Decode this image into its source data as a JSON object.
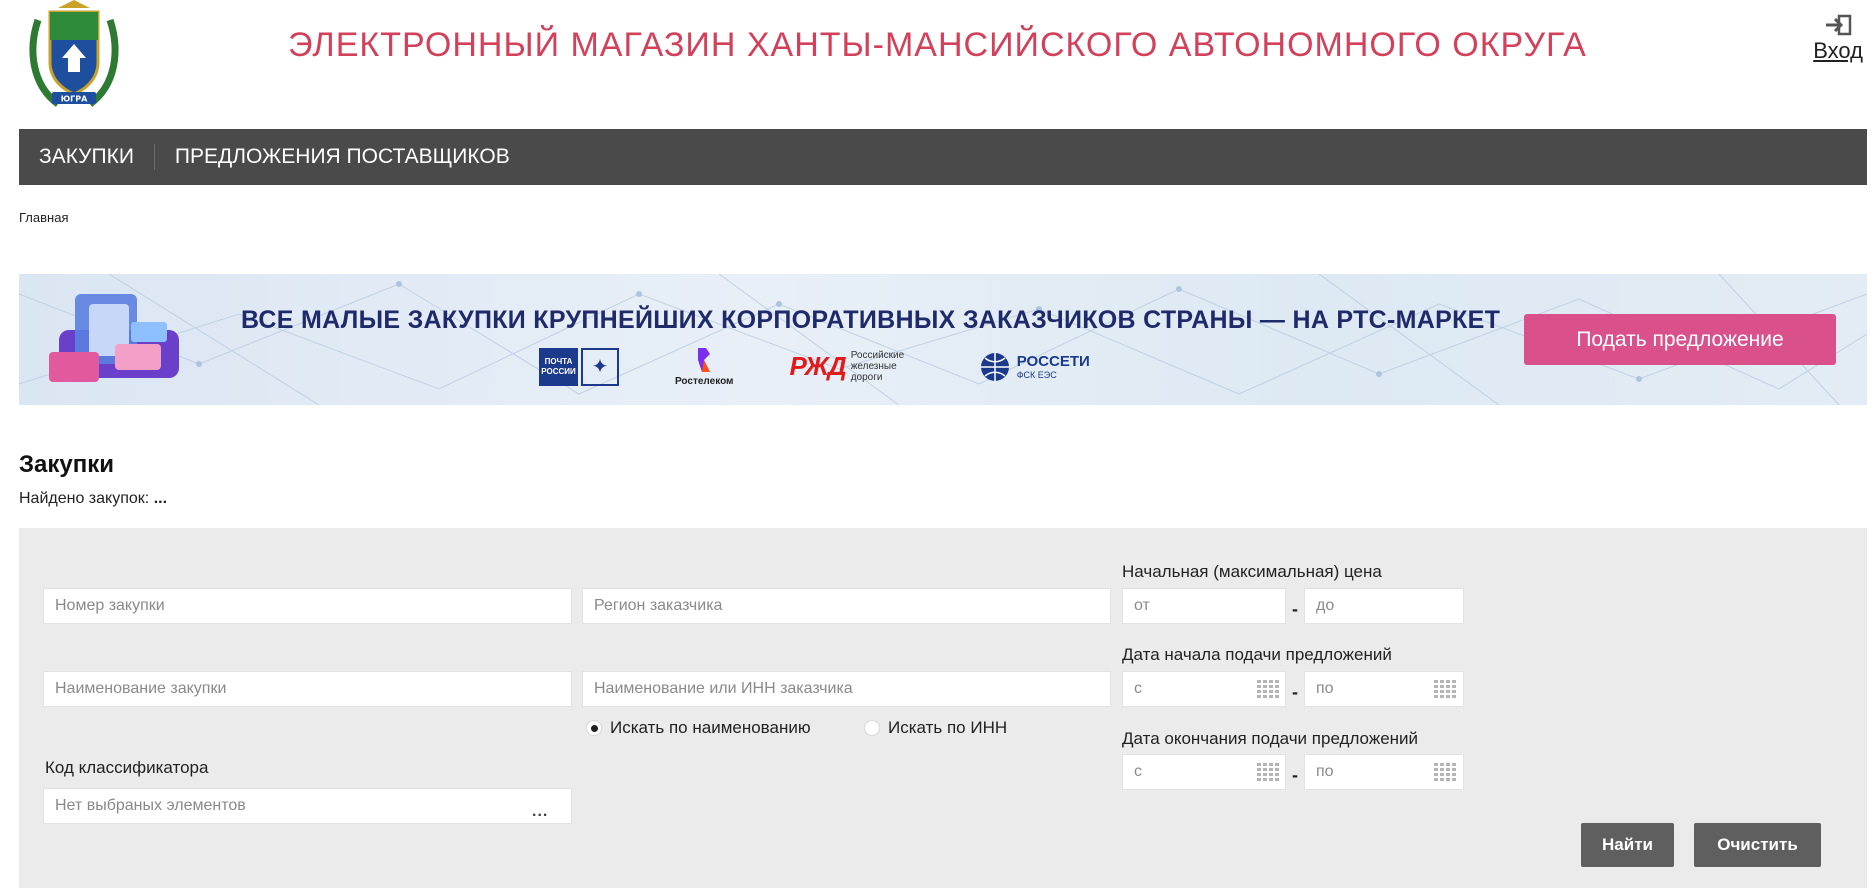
{
  "header": {
    "title": "ЭЛЕКТРОННЫЙ МАГАЗИН ХАНТЫ-МАНСИЙСКОГО АВТОНОМНОГО ОКРУГА",
    "logo_text": "ЮГРА",
    "login_label": "Вход"
  },
  "nav": {
    "items": [
      {
        "label": "ЗАКУПКИ"
      },
      {
        "label": "ПРЕДЛОЖЕНИЯ ПОСТАВЩИКОВ"
      }
    ]
  },
  "breadcrumb": "Главная",
  "banner": {
    "headline": "ВСЕ МАЛЫЕ ЗАКУПКИ КРУПНЕЙШИХ КОРПОРАТИВНЫХ ЗАКАЗЧИКОВ СТРАНЫ — НА РТС-МАРКЕТ",
    "partners": {
      "pochta": "ПОЧТА РОССИИ",
      "rostelecom": "Ростелеком",
      "rzd_mark": "РЖД",
      "rzd_name": "Российские железные дороги",
      "rosseti": "РОССЕТИ",
      "rosseti_sub": "ФСК ЕЭС"
    },
    "cta_label": "Подать предложение",
    "accent_color": "#d9508a"
  },
  "section": {
    "title": "Закупки",
    "found_label": "Найдено закупок:",
    "found_value": "..."
  },
  "filter": {
    "purchase_number_placeholder": "Номер закупки",
    "customer_region_placeholder": "Регион заказчика",
    "purchase_name_placeholder": "Наименование закупки",
    "customer_name_inn_placeholder": "Наименование или ИНН заказчика",
    "price_label": "Начальная (максимальная) цена",
    "price_from_placeholder": "от",
    "price_to_placeholder": "до",
    "start_date_label": "Дата начала подачи предложений",
    "start_from_placeholder": "с",
    "start_to_placeholder": "по",
    "end_date_label": "Дата окончания подачи предложений",
    "end_from_placeholder": "с",
    "end_to_placeholder": "по",
    "dash": "-",
    "radio_by_name": "Искать по наименованию",
    "radio_by_inn": "Искать по ИНН",
    "radio_selected": "by_name",
    "classifier_label": "Код классификатора",
    "classifier_placeholder": "Нет выбраных элементов",
    "classifier_more": "...",
    "find_label": "Найти",
    "clear_label": "Очистить"
  },
  "colors": {
    "title_red": "#d2405a",
    "nav_bg": "#4a4a4a",
    "panel_bg": "#ebebeb",
    "button_bg": "#5f5f5f"
  }
}
